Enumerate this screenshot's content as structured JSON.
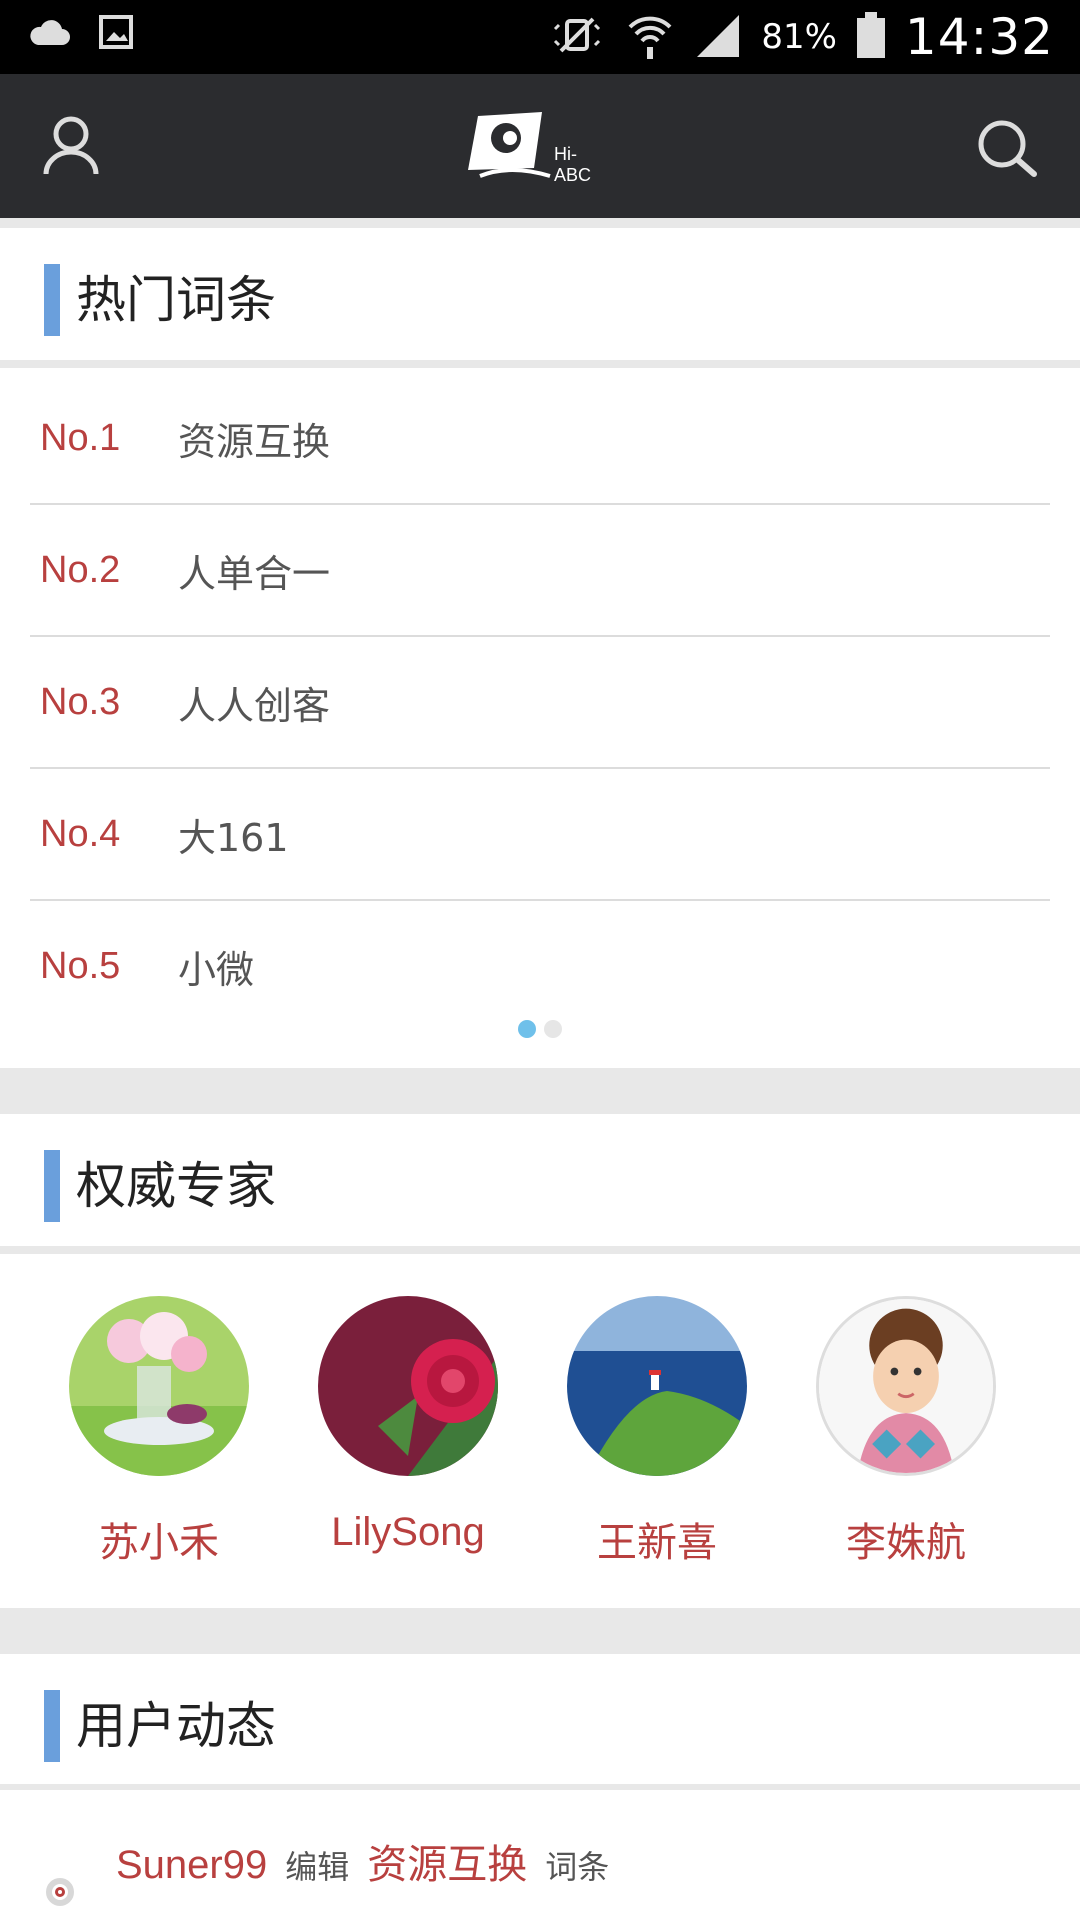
{
  "status_bar": {
    "battery_pct": "81%",
    "time": "14:32",
    "icons": [
      "cloud-icon",
      "gallery-icon",
      "vibrate-off-icon",
      "wifi-icon",
      "signal-icon",
      "battery-icon"
    ]
  },
  "app_bar": {
    "logo_text": "Hi-ABC",
    "icons": [
      "user-icon",
      "search-icon"
    ]
  },
  "hot_terms": {
    "title": "热门词条",
    "items": [
      {
        "rank": "No.1",
        "term": "资源互换"
      },
      {
        "rank": "No.2",
        "term": "人单合一"
      },
      {
        "rank": "No.3",
        "term": "人人创客"
      },
      {
        "rank": "No.4",
        "term": "大161"
      },
      {
        "rank": "No.5",
        "term": "小微"
      }
    ],
    "page_indicator": {
      "pages": 2,
      "current": 1
    }
  },
  "experts": {
    "title": "权威专家",
    "items": [
      {
        "name": "苏小禾",
        "avatar": "flowers-photo"
      },
      {
        "name": "LilySong",
        "avatar": "rose-photo"
      },
      {
        "name": "王新喜",
        "avatar": "coast-photo"
      },
      {
        "name": "李姝航",
        "avatar": "cartoon-boy"
      }
    ]
  },
  "activity": {
    "title": "用户动态",
    "items": [
      {
        "user": "Suner99",
        "action": "编辑",
        "target": "资源互换",
        "kind": "词条"
      }
    ]
  },
  "colors": {
    "accent_blue": "#6a9fdc",
    "rank_red": "#b8403f",
    "appbar_bg": "#2b2c2f",
    "indicator_active": "#6fc0ea"
  }
}
